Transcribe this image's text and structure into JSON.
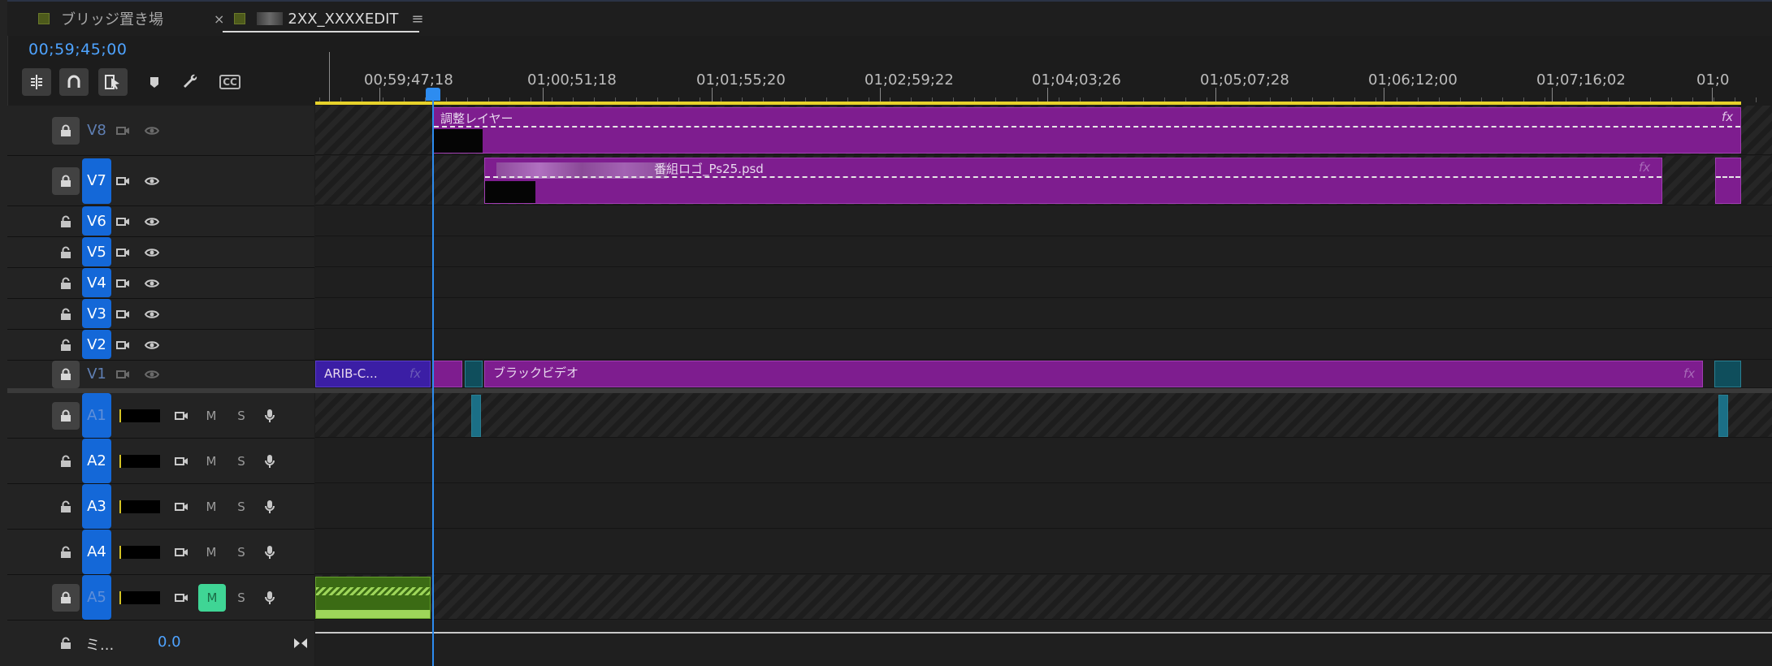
{
  "tabs": [
    {
      "label": "ブリッジ置き場",
      "active": false
    },
    {
      "label": "2XX_XXXXEDIT",
      "active": true,
      "close": "×",
      "menu": "≡"
    }
  ],
  "timecode": "00;59;45;00",
  "toolbar": {
    "icons": [
      "insert-edit-icon",
      "snap-magnet-icon",
      "linked-selection-icon",
      "add-marker-icon",
      "wrench-settings-icon",
      "captions-cc-icon"
    ],
    "cc_label": "CC"
  },
  "ruler": {
    "labels": [
      "00;59;47;18",
      "01;00;51;18",
      "01;01;55;20",
      "01;02;59;22",
      "01;04;03;26",
      "01;05;07;28",
      "01;06;12;00",
      "01;07;16;02",
      "01;0"
    ]
  },
  "video_tracks": [
    {
      "name": "V8",
      "locked": true,
      "targeted": false
    },
    {
      "name": "V7",
      "locked": true,
      "targeted": true
    },
    {
      "name": "V6",
      "locked": false,
      "targeted": true
    },
    {
      "name": "V5",
      "locked": false,
      "targeted": true
    },
    {
      "name": "V4",
      "locked": false,
      "targeted": true
    },
    {
      "name": "V3",
      "locked": false,
      "targeted": true
    },
    {
      "name": "V2",
      "locked": false,
      "targeted": true
    },
    {
      "name": "V1",
      "locked": true,
      "targeted": false
    }
  ],
  "audio_tracks": [
    {
      "name": "A1",
      "locked": true,
      "m": "M",
      "s": "S",
      "mute_on": false
    },
    {
      "name": "A2",
      "locked": false,
      "m": "M",
      "s": "S",
      "mute_on": false
    },
    {
      "name": "A3",
      "locked": false,
      "m": "M",
      "s": "S",
      "mute_on": false
    },
    {
      "name": "A4",
      "locked": false,
      "m": "M",
      "s": "S",
      "mute_on": false
    },
    {
      "name": "A5",
      "locked": true,
      "m": "M",
      "s": "S",
      "mute_on": true
    }
  ],
  "mix": {
    "label": "ミ...",
    "value": "0.0"
  },
  "clips": {
    "v8_label": "調整レイヤー",
    "v7_label": "番組ロゴ_Ps25.psd",
    "v1_arib": "ARIB-C...",
    "v1_black": "ブラックビデオ",
    "fx": "fx"
  },
  "colors": {
    "accent": "#2d8cf0",
    "track_target": "#1468d8",
    "clip_purple": "#7e1d8f",
    "ruler_in_out": "#e7d22b",
    "mute_active": "#3fd595"
  }
}
